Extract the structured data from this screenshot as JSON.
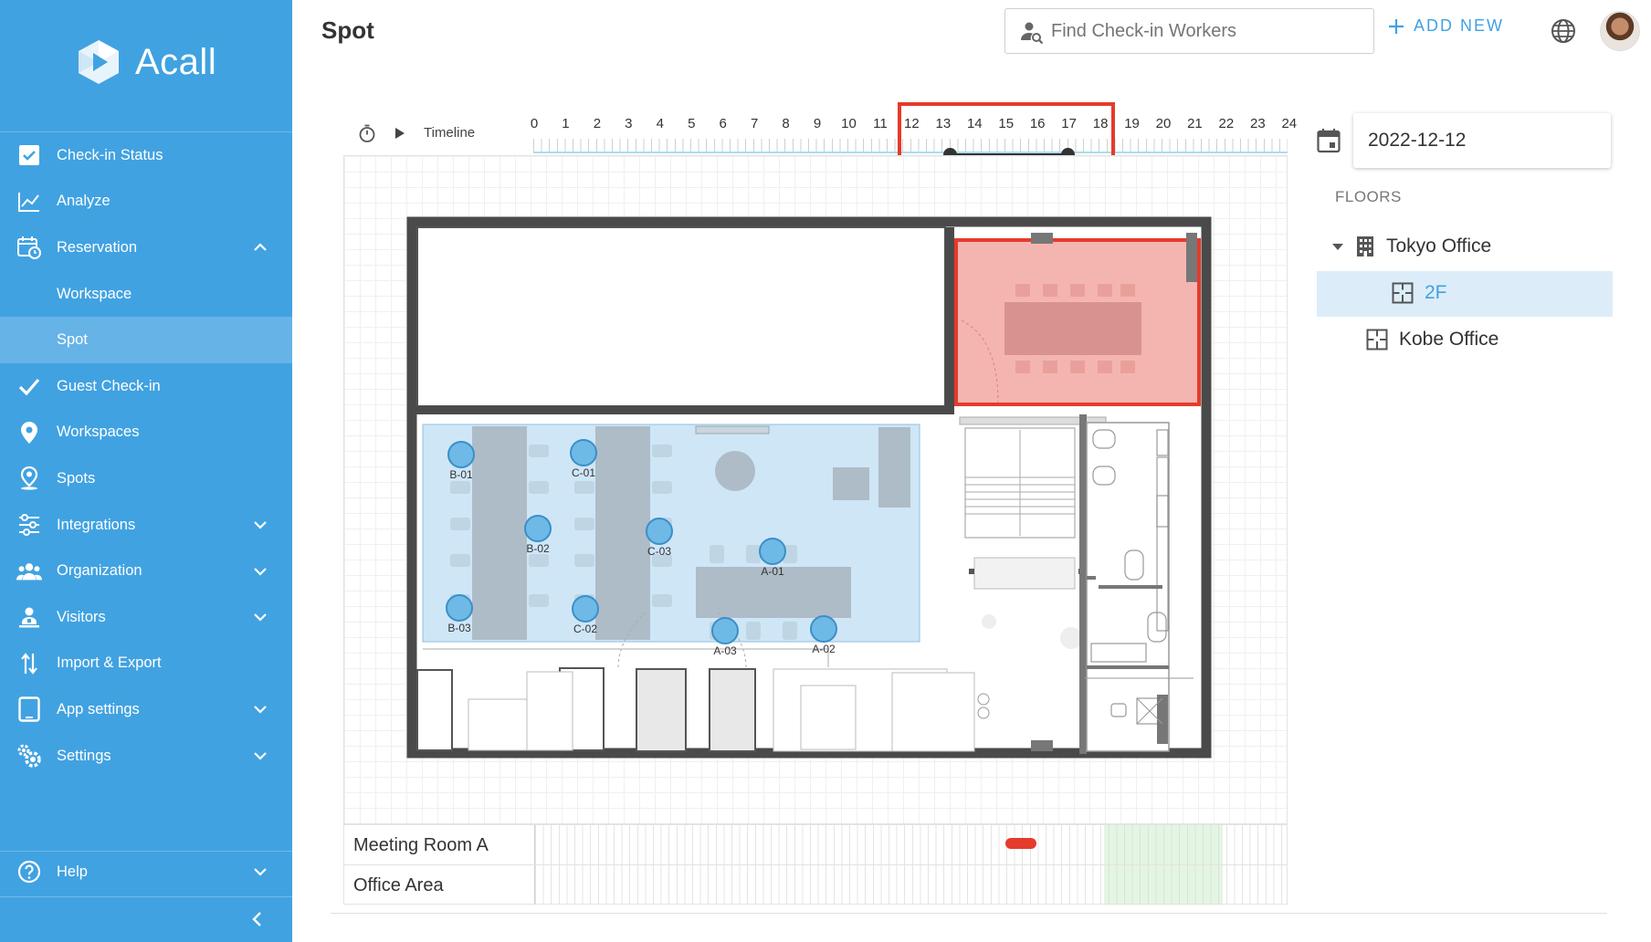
{
  "app": {
    "logo_text": "Acall"
  },
  "sidebar": {
    "items": [
      {
        "label": "Check-in Status",
        "icon": "checkbox-icon"
      },
      {
        "label": "Analyze",
        "icon": "line-chart-icon"
      },
      {
        "label": "Reservation",
        "icon": "calendar-clock-icon",
        "expanded": true
      },
      {
        "label": "Workspace",
        "sub": true
      },
      {
        "label": "Spot",
        "sub": true,
        "active": true
      },
      {
        "label": "Guest Check-in",
        "icon": "check-icon"
      },
      {
        "label": "Workspaces",
        "icon": "location-pin-icon"
      },
      {
        "label": "Spots",
        "icon": "person-pin-icon"
      },
      {
        "label": "Integrations",
        "icon": "sliders-icon",
        "expandable": true
      },
      {
        "label": "Organization",
        "icon": "people-icon",
        "expandable": true
      },
      {
        "label": "Visitors",
        "icon": "visitor-icon",
        "expandable": true
      },
      {
        "label": "Import & Export",
        "icon": "import-export-icon"
      },
      {
        "label": "App settings",
        "icon": "tablet-icon",
        "expandable": true
      },
      {
        "label": "Settings",
        "icon": "gears-icon",
        "expandable": true
      }
    ],
    "help_label": "Help"
  },
  "header": {
    "title": "Spot",
    "search_placeholder": "Find Check-in Workers",
    "add_new_label": "ADD NEW"
  },
  "timeline": {
    "label": "Timeline",
    "hours": [
      "0",
      "1",
      "2",
      "3",
      "4",
      "5",
      "6",
      "7",
      "8",
      "9",
      "10",
      "11",
      "12",
      "13",
      "14",
      "15",
      "16",
      "17",
      "18",
      "19",
      "20",
      "21",
      "22",
      "23",
      "24"
    ],
    "range_start": 13,
    "range_end": 17
  },
  "spots": [
    {
      "id": "B-01"
    },
    {
      "id": "C-01"
    },
    {
      "id": "B-02"
    },
    {
      "id": "C-03"
    },
    {
      "id": "A-01"
    },
    {
      "id": "B-03"
    },
    {
      "id": "C-02"
    },
    {
      "id": "A-03"
    },
    {
      "id": "A-02"
    }
  ],
  "rows": [
    {
      "name": "Meeting Room A"
    },
    {
      "name": "Office Area"
    }
  ],
  "right_panel": {
    "date": "2022-12-12",
    "floors_heading": "FLOORS",
    "tree": [
      {
        "label": "Tokyo Office",
        "type": "building"
      },
      {
        "label": "2F",
        "type": "floor",
        "selected": true
      },
      {
        "label": "Kobe Office",
        "type": "floor"
      }
    ]
  },
  "colors": {
    "sidebar": "#41a2e1",
    "accent": "#41a2e1",
    "highlight": "#e53b2c",
    "reserved_room": "#f4b5b0"
  }
}
